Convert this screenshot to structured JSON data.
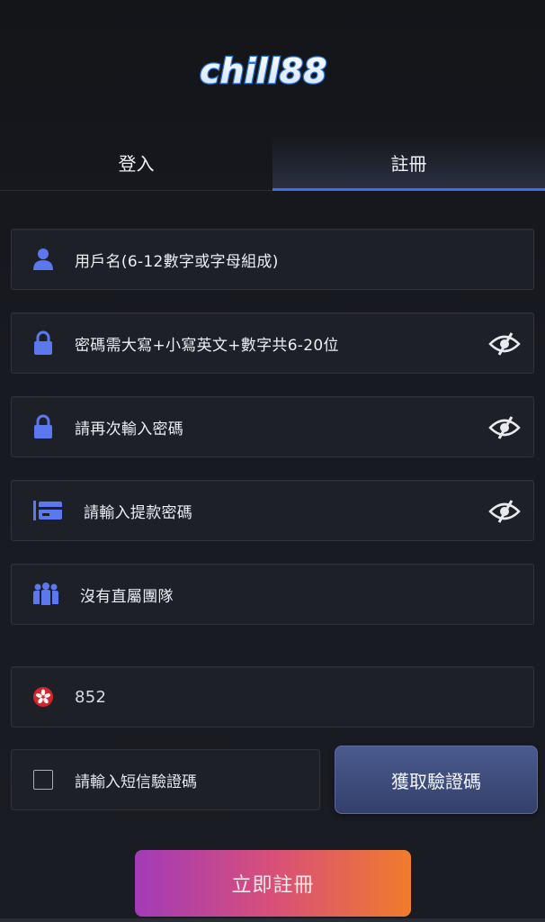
{
  "logo": {
    "text": "chill88",
    "brand_color": "#3aa7f0"
  },
  "tabs": [
    {
      "label": "登入",
      "active": false
    },
    {
      "label": "註冊",
      "active": true
    }
  ],
  "form": {
    "username": {
      "placeholder": "用戶名(6-12數字或字母組成)",
      "icon": "user-icon"
    },
    "password": {
      "placeholder": "密碼需大寫+小寫英文+數字共6-20位",
      "icon": "lock-icon",
      "toggle": "eye-off-icon"
    },
    "confirm_password": {
      "placeholder": "請再次輸入密碼",
      "icon": "lock-icon",
      "toggle": "eye-off-icon"
    },
    "withdraw_password": {
      "placeholder": "請輸入提款密碼",
      "icon": "card-icon",
      "toggle": "eye-off-icon"
    },
    "team": {
      "placeholder": "沒有直屬團隊",
      "icon": "team-icon"
    },
    "phone": {
      "value": "852",
      "icon": "hk-flag-icon"
    },
    "sms": {
      "placeholder": "請輸入短信驗證碼"
    },
    "otp_button": "獲取驗證碼",
    "register_button": "立即註冊"
  },
  "colors": {
    "accent": "#3a6fe6",
    "icon_blue": "#5b78f0",
    "register_gradient": [
      "#a23bb8",
      "#d84f79",
      "#f07c2c"
    ]
  }
}
